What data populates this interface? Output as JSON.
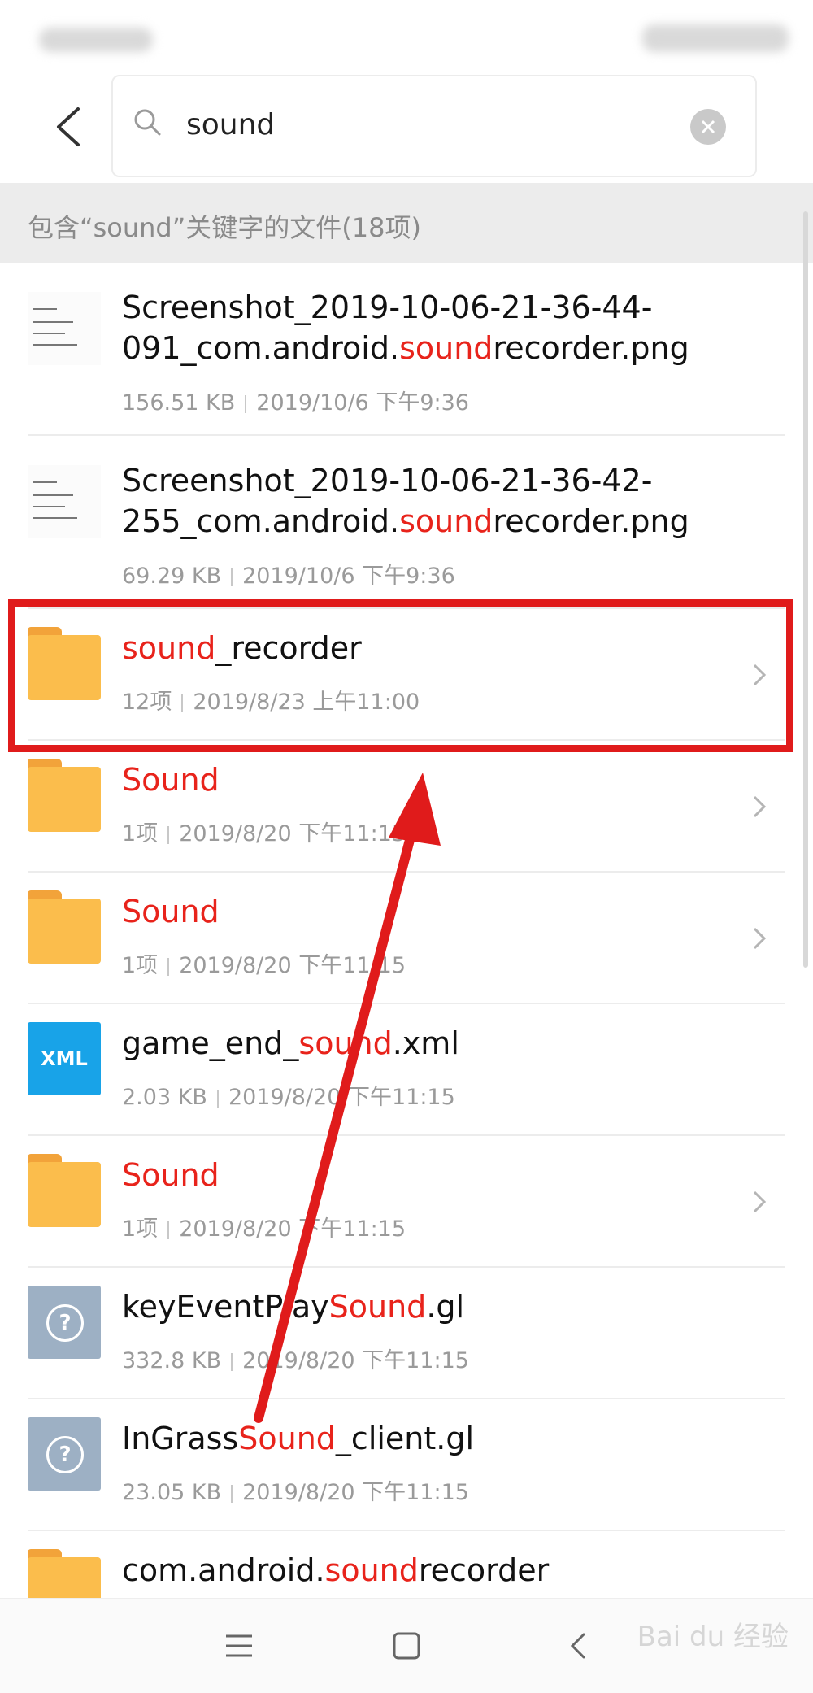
{
  "search": {
    "query": "sound"
  },
  "section_header": "包含“sound”关键字的文件(18项)",
  "files": [
    {
      "type": "image",
      "name_parts": [
        "Screenshot_2019-10-06-21-36-44-091_com.android.",
        "sound",
        "recorder.png"
      ],
      "size": "156.51 KB",
      "date": "2019/10/6 下午9:36"
    },
    {
      "type": "image",
      "name_parts": [
        "Screenshot_2019-10-06-21-36-42-255_com.android.",
        "sound",
        "recorder.png"
      ],
      "size": "69.29 KB",
      "date": "2019/10/6 下午9:36"
    },
    {
      "type": "folder",
      "name_parts": [
        "",
        "sound",
        "_recorder"
      ],
      "size": "12项",
      "date": "2019/8/23 上午11:00"
    },
    {
      "type": "folder",
      "name_parts": [
        "",
        "Sound",
        ""
      ],
      "size": "1项",
      "date": "2019/8/20 下午11:15"
    },
    {
      "type": "folder",
      "name_parts": [
        "",
        "Sound",
        ""
      ],
      "size": "1项",
      "date": "2019/8/20 下午11:15"
    },
    {
      "type": "xml",
      "name_parts": [
        "game_end_",
        "sound",
        ".xml"
      ],
      "size": "2.03 KB",
      "date": "2019/8/20 下午11:15"
    },
    {
      "type": "folder",
      "name_parts": [
        "",
        "Sound",
        ""
      ],
      "size": "1项",
      "date": "2019/8/20 下午11:15"
    },
    {
      "type": "unknown",
      "name_parts": [
        "keyEventPlay",
        "Sound",
        ".gl"
      ],
      "size": "332.8 KB",
      "date": "2019/8/20 下午11:15"
    },
    {
      "type": "unknown",
      "name_parts": [
        "InGrass",
        "Sound",
        "_client.gl"
      ],
      "size": "23.05 KB",
      "date": "2019/8/20 下午11:15"
    },
    {
      "type": "folder",
      "name_parts": [
        "com.android.",
        "sound",
        "recorder"
      ],
      "size": "",
      "date": ""
    }
  ],
  "xml_badge": "XML",
  "watermark": "Bai du 经验",
  "colors": {
    "highlight": "#e8231b",
    "annotation": "#e01b1b",
    "folder": "#fbbd4c"
  }
}
